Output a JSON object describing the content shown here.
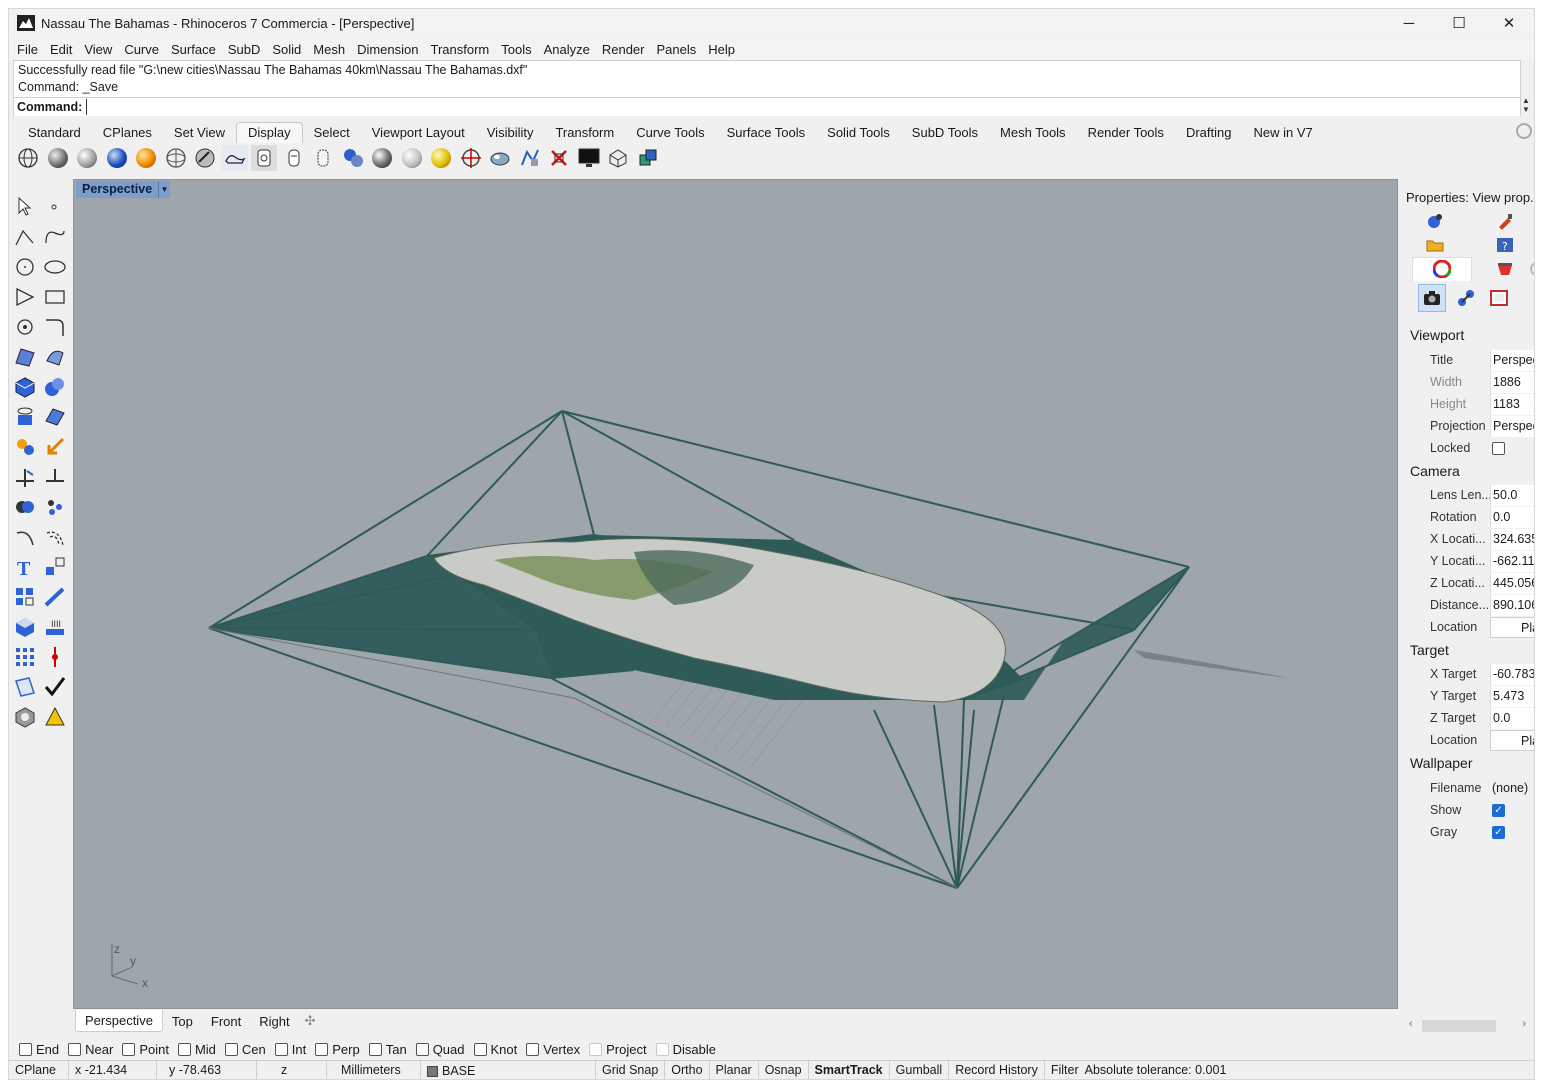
{
  "window": {
    "title": "Nassau The Bahamas - Rhinoceros 7 Commercia - [Perspective]",
    "minimize": "─",
    "maximize": "☐",
    "close": "✕"
  },
  "menu": [
    "File",
    "Edit",
    "View",
    "Curve",
    "Surface",
    "SubD",
    "Solid",
    "Mesh",
    "Dimension",
    "Transform",
    "Tools",
    "Analyze",
    "Render",
    "Panels",
    "Help"
  ],
  "command": {
    "history": [
      "Successfully read file \"G:\\new cities\\Nassau The Bahamas 40km\\Nassau The Bahamas.dxf\"",
      "Command: _Save"
    ],
    "prompt_label": "Command:",
    "input_value": ""
  },
  "toolbar_tabs": [
    "Standard",
    "CPlanes",
    "Set View",
    "Display",
    "Select",
    "Viewport Layout",
    "Visibility",
    "Transform",
    "Curve Tools",
    "Surface Tools",
    "Solid Tools",
    "SubD Tools",
    "Mesh Tools",
    "Render Tools",
    "Drafting",
    "New in V7"
  ],
  "active_tab": "Display",
  "display_tools": [
    "wireframe-icon",
    "shaded-icon",
    "rendered-icon",
    "ghosted-icon",
    "xray-icon",
    "technical-icon",
    "artistic-icon",
    "pen-icon",
    "arctic-icon",
    "raytraced-icon",
    "monochrome-icon",
    "render-mode-icon",
    "set-object-display-icon",
    "analysis-mode-icon",
    "show-edges-icon",
    "zebra-icon",
    "environment-map-icon",
    "curvature-icon",
    "draft-angle-icon",
    "turn-off-icon",
    "monitor-icon",
    "clipping-plane-icon",
    "lights-icon"
  ],
  "viewport": {
    "name": "Perspective",
    "axes": {
      "z": "z",
      "y": "y",
      "x": "x"
    },
    "colors": {
      "background": "#9ea6ab",
      "mesh": "#2e5a58"
    }
  },
  "viewport_tabs": [
    "Perspective",
    "Top",
    "Front",
    "Right"
  ],
  "active_viewport_tab": "Perspective",
  "osnaps": [
    {
      "label": "End",
      "checked": false
    },
    {
      "label": "Near",
      "checked": false
    },
    {
      "label": "Point",
      "checked": false
    },
    {
      "label": "Mid",
      "checked": false
    },
    {
      "label": "Cen",
      "checked": false
    },
    {
      "label": "Int",
      "checked": false
    },
    {
      "label": "Perp",
      "checked": false
    },
    {
      "label": "Tan",
      "checked": false
    },
    {
      "label": "Quad",
      "checked": false
    },
    {
      "label": "Knot",
      "checked": false
    },
    {
      "label": "Vertex",
      "checked": false
    },
    {
      "label": "Project",
      "checked": false
    },
    {
      "label": "Disable",
      "checked": false
    }
  ],
  "status": {
    "cplane": "CPlane",
    "x": "x -21.434",
    "y": "y -78.463",
    "z": "z",
    "units": "Millimeters",
    "layer": "BASE",
    "toggles": [
      "Grid Snap",
      "Ortho",
      "Planar",
      "Osnap",
      "SmartTrack",
      "Gumball",
      "Record History",
      "Filter"
    ],
    "active_toggle": "SmartTrack",
    "tolerance": "Absolute tolerance: 0.001"
  },
  "properties": {
    "title": "Properties: View prop...",
    "sections": {
      "viewport": "Viewport",
      "camera": "Camera",
      "target": "Target",
      "wallpaper": "Wallpaper"
    },
    "viewport": {
      "title_label": "Title",
      "title_value": "Perspective",
      "width_label": "Width",
      "width_value": "1886",
      "height_label": "Height",
      "height_value": "1183",
      "projection_label": "Projection",
      "projection_value": "Perspective",
      "locked_label": "Locked",
      "locked": false
    },
    "camera": {
      "lens_label": "Lens Len...",
      "lens_value": "50.0",
      "rotation_label": "Rotation",
      "rotation_value": "0.0",
      "xloc_label": "X Locati...",
      "xloc_value": "324.635",
      "yloc_label": "Y Locati...",
      "yloc_value": "-662.11",
      "zloc_label": "Z Locati...",
      "zloc_value": "445.056",
      "distance_label": "Distance...",
      "distance_value": "890.106",
      "location_label": "Location",
      "location_button": "Place..."
    },
    "target": {
      "x_label": "X Target",
      "x_value": "-60.783",
      "y_label": "Y Target",
      "y_value": "5.473",
      "z_label": "Z Target",
      "z_value": "0.0",
      "location_label": "Location",
      "location_button": "Place..."
    },
    "wallpaper": {
      "filename_label": "Filename",
      "filename_value": "(none)",
      "show_label": "Show",
      "show": true,
      "gray_label": "Gray",
      "gray": true
    }
  }
}
